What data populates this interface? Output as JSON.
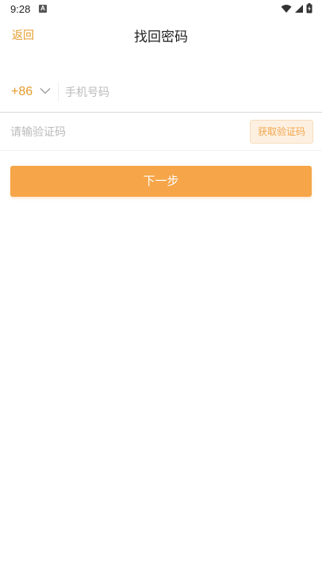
{
  "status_bar": {
    "time": "9:28",
    "notification_icon": "a-icon",
    "icons": [
      "wifi-icon",
      "signal-icon",
      "battery-charging-icon"
    ]
  },
  "header": {
    "back_label": "返回",
    "title": "找回密码"
  },
  "form": {
    "country_code": "+86",
    "phone_placeholder": "手机号码",
    "code_placeholder": "请输验证码",
    "get_code_label": "获取验证码"
  },
  "actions": {
    "next_label": "下一步"
  },
  "colors": {
    "accent": "#e59b2a",
    "primary_button": "#f6a548",
    "secondary_button_bg": "#fdf0e1",
    "secondary_button_text": "#f3a64d"
  }
}
